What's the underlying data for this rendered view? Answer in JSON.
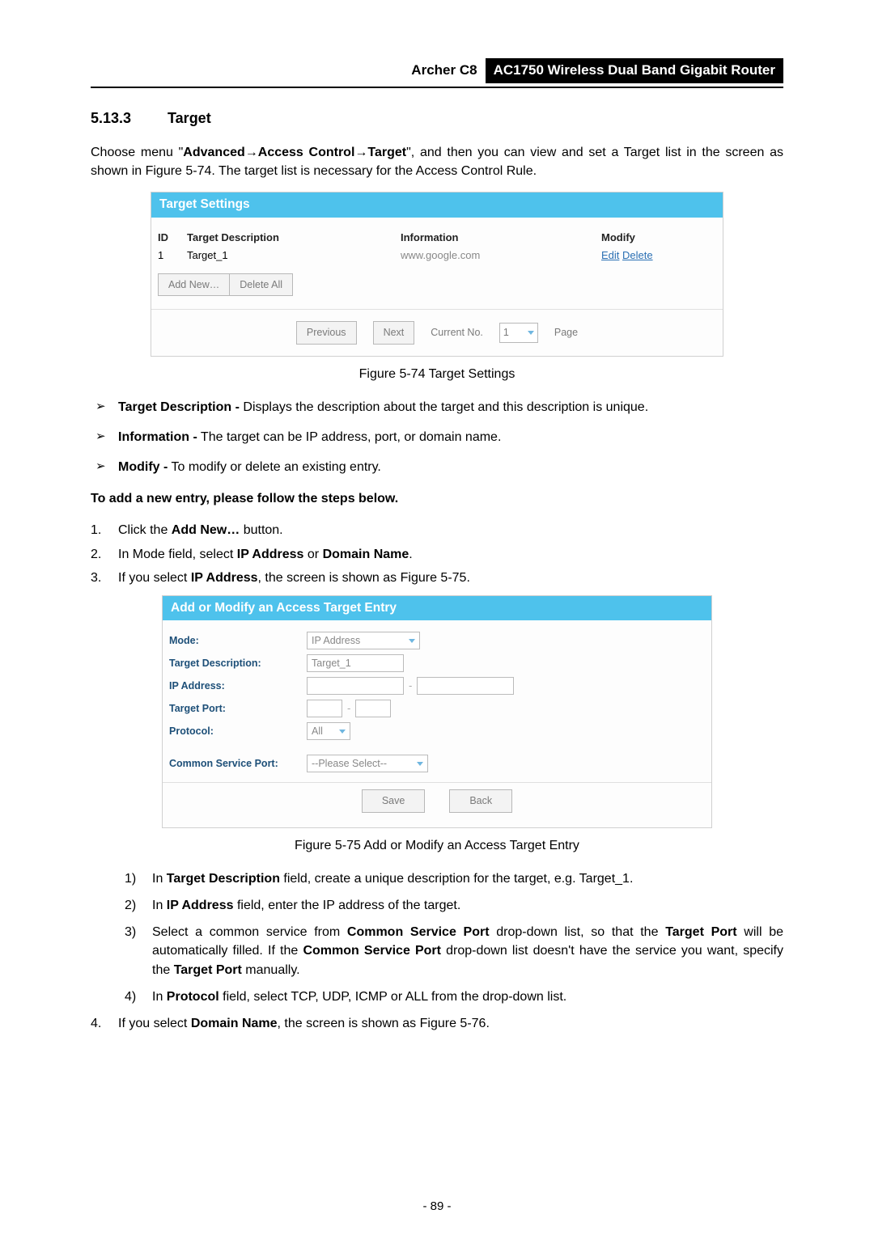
{
  "header": {
    "model": "Archer C8",
    "title": "AC1750 Wireless Dual Band Gigabit Router"
  },
  "section": {
    "number": "5.13.3",
    "title": "Target"
  },
  "intro": {
    "pre": "Choose menu \"",
    "nav1": "Advanced",
    "nav2": "Access Control",
    "nav3": "Target",
    "post": "\", and then you can view and set a Target list in the screen as shown in Figure 5-74. The target list is necessary for the Access Control Rule."
  },
  "target_settings": {
    "title": "Target Settings",
    "headers": {
      "id": "ID",
      "desc": "Target Description",
      "info": "Information",
      "modify": "Modify"
    },
    "row": {
      "id": "1",
      "desc": "Target_1",
      "info": "www.google.com",
      "edit": "Edit",
      "delete": "Delete"
    },
    "buttons": {
      "add_new": "Add New…",
      "delete_all": "Delete All"
    },
    "pager": {
      "prev": "Previous",
      "next": "Next",
      "current_label": "Current No.",
      "current_value": "1",
      "page_label": "Page"
    }
  },
  "fig74_caption": "Figure 5-74 Target Settings",
  "bullets": {
    "b1_label": "Target Description -",
    "b1_text": " Displays the description about the target and this description is unique.",
    "b2_label": "Information -",
    "b2_text": " The target can be IP address, port, or domain name.",
    "b3_label": "Modify -",
    "b3_text": " To modify or delete an existing entry."
  },
  "add_entry_heading": "To add a new entry, please follow the steps below.",
  "steps": {
    "s1_pre": "Click the ",
    "s1_bold": "Add New…",
    "s1_post": " button.",
    "s2_pre": "In Mode field, select ",
    "s2_b1": "IP Address",
    "s2_mid": " or ",
    "s2_b2": "Domain Name",
    "s2_post": ".",
    "s3_pre": "If you select ",
    "s3_bold": "IP Address",
    "s3_post": ", the screen is shown as Figure 5-75."
  },
  "form": {
    "title": "Add or Modify an Access Target Entry",
    "labels": {
      "mode": "Mode:",
      "target_desc": "Target Description:",
      "ip": "IP Address:",
      "port": "Target Port:",
      "protocol": "Protocol:",
      "csp": "Common Service Port:"
    },
    "values": {
      "mode": "IP Address",
      "target_desc": "Target_1",
      "protocol": "All",
      "csp": "--Please Select--"
    },
    "buttons": {
      "save": "Save",
      "back": "Back"
    }
  },
  "fig75_caption": "Figure 5-75 Add or Modify an Access Target Entry",
  "sub_steps": {
    "ss1_a": "In ",
    "ss1_b": "Target Description",
    "ss1_c": " field, create a unique description for the target, e.g. Target_1.",
    "ss2_a": "In ",
    "ss2_b": "IP Address",
    "ss2_c": " field, enter the IP address of the target.",
    "ss3_a": "Select a common service from ",
    "ss3_b": "Common Service Port",
    "ss3_c": " drop-down list, so that the ",
    "ss3_d": "Target Port",
    "ss3_e": " will be automatically filled. If the ",
    "ss3_f": "Common Service Port",
    "ss3_g": " drop-down list doesn't have the service you want, specify the ",
    "ss3_h": "Target Port",
    "ss3_i": " manually.",
    "ss4_a": "In ",
    "ss4_b": "Protocol",
    "ss4_c": " field, select TCP, UDP, ICMP or ALL from the drop-down list."
  },
  "step4": {
    "a": "If you select ",
    "b": "Domain Name",
    "c": ", the screen is shown as Figure 5-76."
  },
  "page_number": "- 89 -"
}
